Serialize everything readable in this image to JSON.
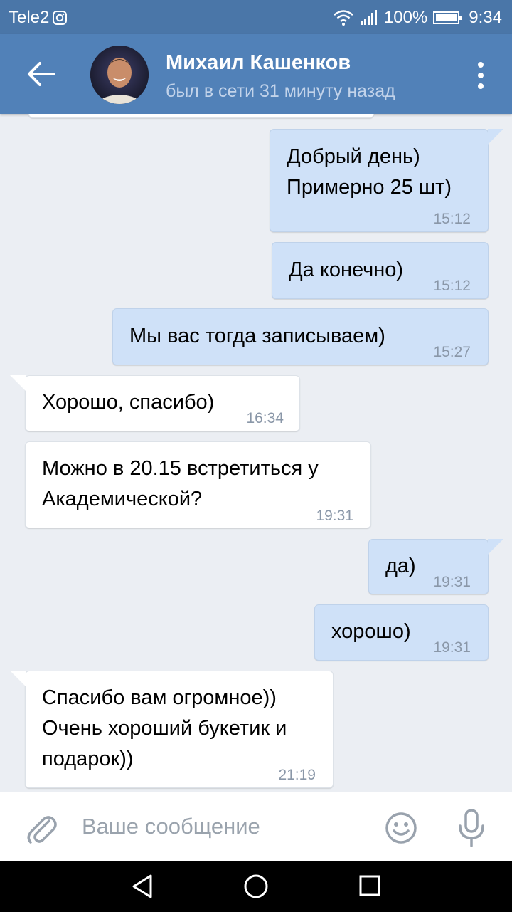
{
  "status_bar": {
    "carrier": "Tele2",
    "battery": "100%",
    "time": "9:34"
  },
  "header": {
    "contact_name": "Михаил Кашенков",
    "last_seen": "был в сети 31 минуту назад"
  },
  "messages": [
    {
      "direction": "outgoing",
      "lines": [
        "Добрый день)",
        "Примерно 25 шт)"
      ],
      "time": "15:12"
    },
    {
      "direction": "outgoing",
      "lines": [
        "Да конечно)"
      ],
      "time": "15:12"
    },
    {
      "direction": "outgoing",
      "lines": [
        "Мы вас тогда записываем)"
      ],
      "time": "15:27"
    },
    {
      "direction": "incoming",
      "lines": [
        "Хорошо, спасибо)"
      ],
      "time": "16:34"
    },
    {
      "direction": "incoming",
      "lines": [
        "Можно в 20.15 встретиться у",
        "Академической?"
      ],
      "time": "19:31"
    },
    {
      "direction": "outgoing",
      "lines": [
        "да)"
      ],
      "time": "19:31"
    },
    {
      "direction": "outgoing",
      "lines": [
        "хорошо)"
      ],
      "time": "19:31"
    },
    {
      "direction": "incoming",
      "lines": [
        "Спасибо вам огромное))",
        "Очень хороший букетик и",
        "подарок))"
      ],
      "time": "21:19"
    }
  ],
  "composer": {
    "placeholder": "Ваше сообщение"
  },
  "icons": {
    "back": "arrow-left-icon",
    "menu": "more-vertical-icon",
    "attach": "paperclip-icon",
    "emoji": "smiley-icon",
    "mic": "microphone-icon",
    "nav_back": "triangle-back-icon",
    "nav_home": "circle-home-icon",
    "nav_recents": "square-recents-icon"
  },
  "colors": {
    "status_bar": "#4a76a8",
    "header": "#5181b8",
    "chat_background": "#ebeef3",
    "outgoing_bubble": "#cfe1f8",
    "incoming_bubble": "#ffffff"
  }
}
